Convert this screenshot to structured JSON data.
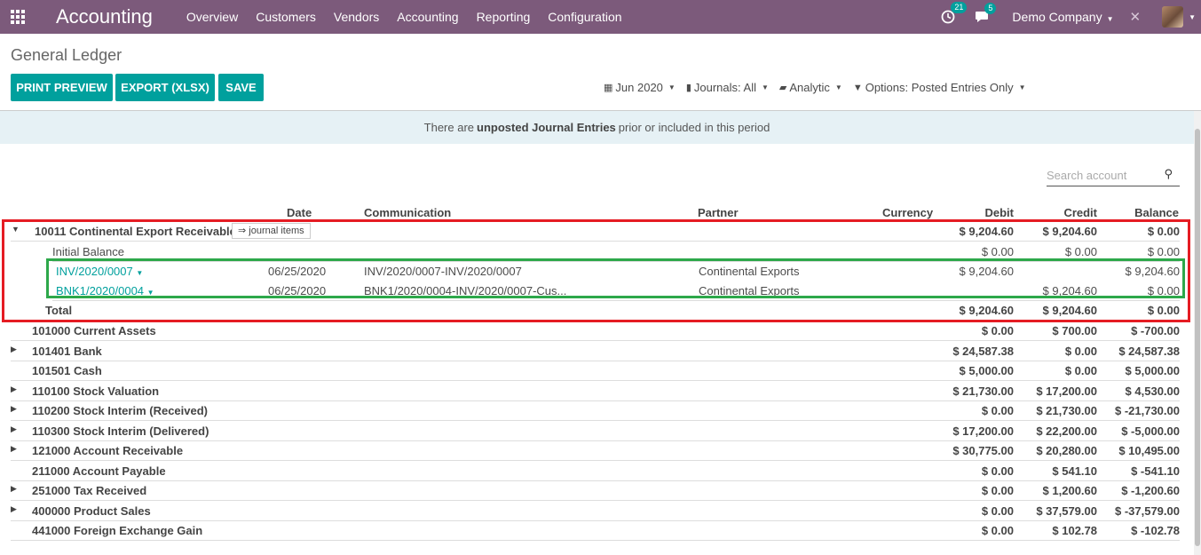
{
  "app": {
    "brand": "Accounting"
  },
  "nav": {
    "menu": [
      "Overview",
      "Customers",
      "Vendors",
      "Accounting",
      "Reporting",
      "Configuration"
    ],
    "activity_count": "21",
    "messages_count": "5",
    "company": "Demo Company"
  },
  "page": {
    "title": "General Ledger"
  },
  "buttons": {
    "print_preview": "PRINT PREVIEW",
    "export": "EXPORT (XLSX)",
    "save": "SAVE"
  },
  "filters": {
    "date": "Jun 2020",
    "journals": "Journals: All",
    "analytic": "Analytic",
    "options": "Options: Posted Entries Only"
  },
  "alert": {
    "prefix": "There are",
    "emph": "unposted Journal Entries",
    "suffix": "prior or included in this period"
  },
  "search": {
    "placeholder": "Search account"
  },
  "columns": {
    "date": "Date",
    "communication": "Communication",
    "partner": "Partner",
    "currency": "Currency",
    "debit": "Debit",
    "credit": "Credit",
    "balance": "Balance"
  },
  "expanded": {
    "account": "10011 Continental Export Receivable",
    "journal_btn": "⇒ journal items",
    "debit": "$ 9,204.60",
    "credit": "$ 9,204.60",
    "balance": "$ 0.00",
    "initial": {
      "label": "Initial Balance",
      "debit": "$ 0.00",
      "credit": "$ 0.00",
      "balance": "$ 0.00"
    },
    "lines": [
      {
        "ref": "INV/2020/0007",
        "date": "06/25/2020",
        "communication": "INV/2020/0007-INV/2020/0007",
        "partner": "Continental Exports",
        "debit": "$ 9,204.60",
        "credit": "",
        "balance": "$ 9,204.60"
      },
      {
        "ref": "BNK1/2020/0004",
        "date": "06/25/2020",
        "communication": "BNK1/2020/0004-INV/2020/0007-Cus...",
        "partner": "Continental Exports",
        "debit": "",
        "credit": "$ 9,204.60",
        "balance": "$ 0.00"
      }
    ],
    "total": {
      "label": "Total",
      "debit": "$ 9,204.60",
      "credit": "$ 9,204.60",
      "balance": "$ 0.00"
    }
  },
  "accounts": [
    {
      "name": "101000 Current Assets",
      "expandable": false,
      "debit": "$ 0.00",
      "credit": "$ 700.00",
      "balance": "$ -700.00"
    },
    {
      "name": "101401 Bank",
      "expandable": true,
      "debit": "$ 24,587.38",
      "credit": "$ 0.00",
      "balance": "$ 24,587.38"
    },
    {
      "name": "101501 Cash",
      "expandable": false,
      "debit": "$ 5,000.00",
      "credit": "$ 0.00",
      "balance": "$ 5,000.00"
    },
    {
      "name": "110100 Stock Valuation",
      "expandable": true,
      "debit": "$ 21,730.00",
      "credit": "$ 17,200.00",
      "balance": "$ 4,530.00"
    },
    {
      "name": "110200 Stock Interim (Received)",
      "expandable": true,
      "debit": "$ 0.00",
      "credit": "$ 21,730.00",
      "balance": "$ -21,730.00"
    },
    {
      "name": "110300 Stock Interim (Delivered)",
      "expandable": true,
      "debit": "$ 17,200.00",
      "credit": "$ 22,200.00",
      "balance": "$ -5,000.00"
    },
    {
      "name": "121000 Account Receivable",
      "expandable": true,
      "debit": "$ 30,775.00",
      "credit": "$ 20,280.00",
      "balance": "$ 10,495.00"
    },
    {
      "name": "211000 Account Payable",
      "expandable": false,
      "debit": "$ 0.00",
      "credit": "$ 541.10",
      "balance": "$ -541.10"
    },
    {
      "name": "251000 Tax Received",
      "expandable": true,
      "debit": "$ 0.00",
      "credit": "$ 1,200.60",
      "balance": "$ -1,200.60"
    },
    {
      "name": "400000 Product Sales",
      "expandable": true,
      "debit": "$ 0.00",
      "credit": "$ 37,579.00",
      "balance": "$ -37,579.00"
    },
    {
      "name": "441000 Foreign Exchange Gain",
      "expandable": false,
      "debit": "$ 0.00",
      "credit": "$ 102.78",
      "balance": "$ -102.78"
    }
  ]
}
